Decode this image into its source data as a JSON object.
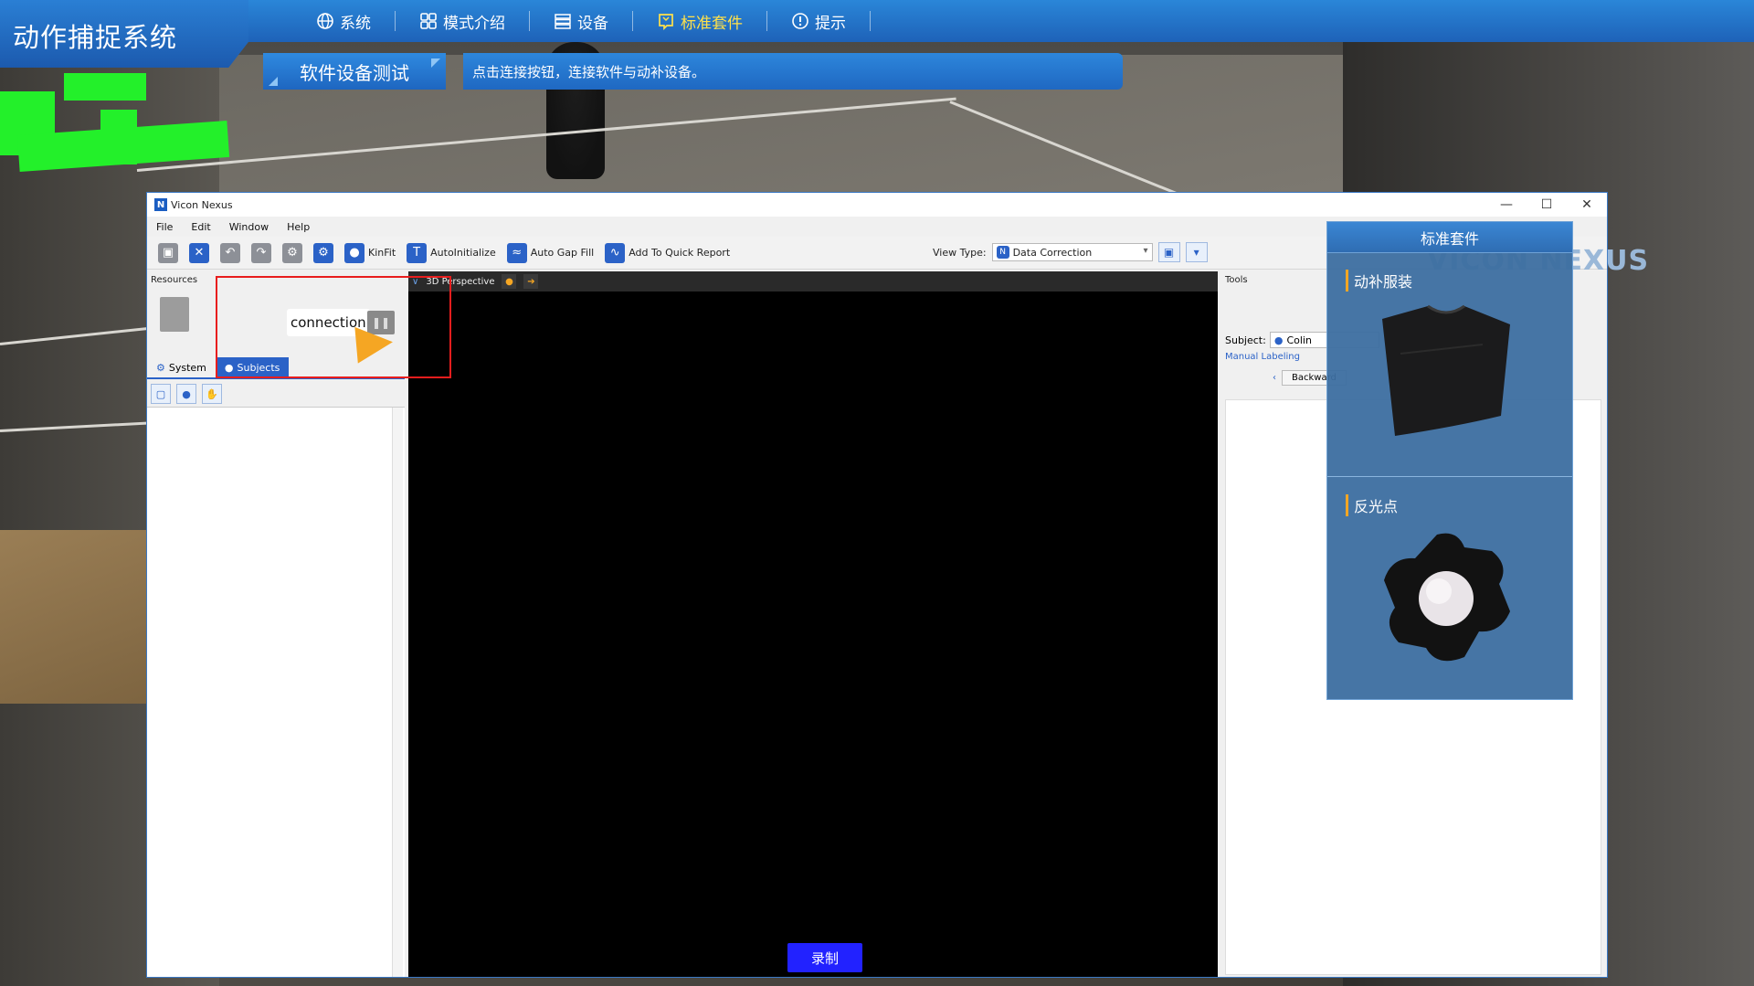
{
  "app": {
    "title": "动作捕捉系统"
  },
  "nav": {
    "items": [
      {
        "label": "系统",
        "icon": "globe-icon"
      },
      {
        "label": "模式介绍",
        "icon": "grid-icon"
      },
      {
        "label": "设备",
        "icon": "server-icon"
      },
      {
        "label": "标准套件",
        "icon": "book-icon",
        "active": true
      },
      {
        "label": "提示",
        "icon": "info-icon"
      }
    ],
    "active_color": "#ffe14a"
  },
  "step": {
    "label": "软件设备测试"
  },
  "hint": {
    "text": "点击连接按钮，连接软件与动补设备。"
  },
  "vicon": {
    "window_title": "Vicon Nexus",
    "menu": [
      "File",
      "Edit",
      "Window",
      "Help"
    ],
    "toolbar": {
      "kinfit": "KinFit",
      "autoinit": "AutoInitialize",
      "autogap": "Auto Gap Fill",
      "quickreport": "Add To Quick Report"
    },
    "view_type_label": "View Type:",
    "view_type_value": "Data Correction",
    "resources_label": "Resources",
    "tabs": {
      "system": "System",
      "subjects": "Subjects"
    },
    "viewport_label": "3D Perspective",
    "tools_label": "Tools",
    "subject_label": "Subject:",
    "subject_value": "Colin",
    "manual_labeling": "Manual Labeling",
    "backward": "Backward",
    "logo_text": "VICON NEXUS"
  },
  "tooltip": {
    "text": "connection"
  },
  "record": {
    "label": "录制"
  },
  "kit": {
    "title": "标准套件",
    "items": [
      {
        "label": "动补服装",
        "icon": "shirt-icon"
      },
      {
        "label": "反光点",
        "icon": "marker-icon"
      }
    ]
  },
  "colors": {
    "accent": "#2b62c7",
    "highlight": "#e81d1d",
    "record": "#2222ff"
  }
}
